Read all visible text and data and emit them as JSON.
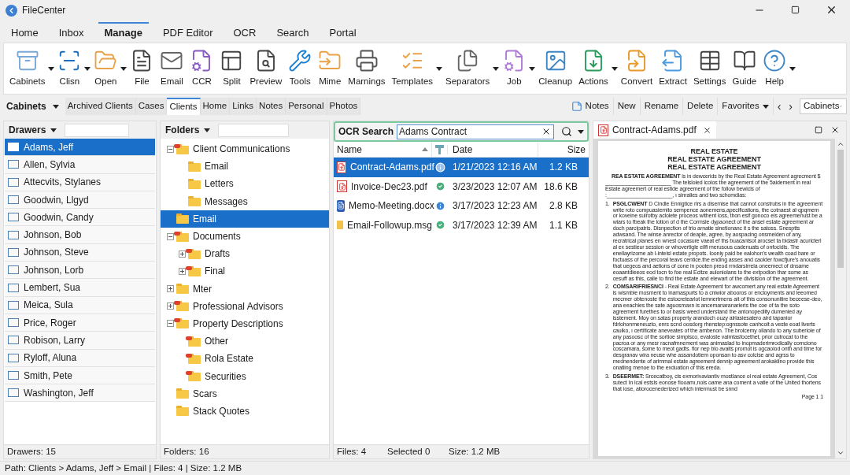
{
  "window": {
    "title": "FileCenter"
  },
  "menu_tabs": [
    {
      "label": "Home",
      "selected": false
    },
    {
      "label": "Inbox",
      "selected": false
    },
    {
      "label": "Manage",
      "selected": true
    },
    {
      "label": "PDF Editor",
      "selected": false
    },
    {
      "label": "OCR",
      "selected": false
    },
    {
      "label": "Search",
      "selected": false
    },
    {
      "label": "Portal",
      "selected": false
    }
  ],
  "ribbon": [
    {
      "label": "Cabinets",
      "dropdown": true
    },
    {
      "label": "Clisn",
      "dropdown": true
    },
    {
      "label": "Open",
      "dropdown": true
    },
    {
      "label": "File",
      "dropdown": false
    },
    {
      "label": "Email",
      "dropdown": false
    },
    {
      "label": "CCR",
      "dropdown": false
    },
    {
      "label": "Split",
      "dropdown": false
    },
    {
      "label": "Preview",
      "dropdown": false
    },
    {
      "label": "Tools",
      "dropdown": false
    },
    {
      "label": "Mime",
      "dropdown": false
    },
    {
      "label": "Marnings",
      "dropdown": false
    },
    {
      "label": "Templates",
      "dropdown": true
    },
    {
      "label": "Separators",
      "dropdown": true
    },
    {
      "label": "Job",
      "dropdown": true
    },
    {
      "label": "Cleanup",
      "dropdown": false
    },
    {
      "label": "Actions",
      "dropdown": true
    },
    {
      "label": "Convert",
      "dropdown": false
    },
    {
      "label": "Extract",
      "dropdown": false
    },
    {
      "label": "Settings",
      "dropdown": false
    },
    {
      "label": "Guide",
      "dropdown": false
    },
    {
      "label": "Help",
      "dropdown": true
    }
  ],
  "cabinet_bar": {
    "label": "Cabinets",
    "tabs": [
      {
        "label": "Archived Clients",
        "selected": false
      },
      {
        "label": "Cases",
        "selected": false
      },
      {
        "label": "Clients",
        "selected": true
      },
      {
        "label": "Home",
        "selected": false
      },
      {
        "label": "Links",
        "selected": false
      },
      {
        "label": "Notes",
        "selected": false
      },
      {
        "label": "Personal",
        "selected": false
      },
      {
        "label": "Photos",
        "selected": false
      }
    ],
    "actions": [
      "Notes",
      "New",
      "Rename",
      "Delete",
      "Favorites"
    ],
    "nav_back": "‹",
    "nav_forward": "›",
    "cabinet_select": "Cabinets"
  },
  "drawers": {
    "title": "Drawers",
    "items": [
      {
        "label": "Adams, Jeff",
        "selected": true
      },
      {
        "label": "Allen, Sylvia",
        "selected": false
      },
      {
        "label": "Attecvits, Stylanes",
        "selected": false
      },
      {
        "label": "Goodwin, Llgyd",
        "selected": false
      },
      {
        "label": "Goodwin, Candy",
        "selected": false
      },
      {
        "label": "Johnson, Bob",
        "selected": false
      },
      {
        "label": "Johnson, Steve",
        "selected": false
      },
      {
        "label": "Johnson, Lorb",
        "selected": false
      },
      {
        "label": "Lembert, Sua",
        "selected": false
      },
      {
        "label": "Meica, Sula",
        "selected": false
      },
      {
        "label": "Price, Roger",
        "selected": false
      },
      {
        "label": "Robison, Larry",
        "selected": false
      },
      {
        "label": "Ryloff, Aluna",
        "selected": false
      },
      {
        "label": "Smith, Pete",
        "selected": false
      },
      {
        "label": "Washington, Jeff",
        "selected": false
      }
    ],
    "status": "Drawers: 15"
  },
  "folders": {
    "title": "Folders",
    "items": [
      {
        "label": "Client Communications",
        "linked": true,
        "expanded": true,
        "selected": false,
        "children": [
          {
            "label": "Email",
            "linked": false,
            "selected": false
          },
          {
            "label": "Letters",
            "linked": false,
            "selected": false
          },
          {
            "label": "Messages",
            "linked": false,
            "selected": false
          }
        ]
      },
      {
        "label": "Email",
        "linked": false,
        "selected": true
      },
      {
        "label": "Documents",
        "linked": true,
        "expanded": true,
        "selected": false,
        "children": [
          {
            "label": "Drafts",
            "linked": true,
            "expanded": false,
            "selected": false
          },
          {
            "label": "Final",
            "linked": true,
            "expanded": false,
            "selected": false
          }
        ]
      },
      {
        "label": "Mter",
        "linked": false,
        "expanded": false,
        "selected": false
      },
      {
        "label": "Professional Advisors",
        "linked": true,
        "expanded": false,
        "selected": false
      },
      {
        "label": "Property Descriptions",
        "linked": true,
        "expanded": true,
        "selected": false,
        "children": [
          {
            "label": "Other",
            "linked": true,
            "selected": false
          },
          {
            "label": "Rola Estate",
            "linked": true,
            "selected": false
          },
          {
            "label": "Securities",
            "linked": true,
            "selected": false
          }
        ]
      },
      {
        "label": "Scars",
        "linked": false,
        "selected": false
      },
      {
        "label": "Stack Quotes",
        "linked": false,
        "selected": false
      }
    ],
    "status": "Folders: 16"
  },
  "files": {
    "search_label": "OCR Search",
    "search_value": "Adams Contract",
    "columns": [
      "Name",
      "Date",
      "Size"
    ],
    "rows": [
      {
        "name": "Contract-Adams.pdf",
        "kind": "pdf",
        "ocr_done": false,
        "date": "1/21/2023 12:16 AM",
        "size": "1.2 KB",
        "selected": true
      },
      {
        "name": "Invoice-Dec23.pdf",
        "kind": "pdf",
        "ocr_done": true,
        "date": "3/23/2023 12:07 AM",
        "size": "18.6 KB",
        "selected": false
      },
      {
        "name": "Memo-Meeting.docx",
        "kind": "docx",
        "ocr_done": false,
        "date": "3/17/2023 12:23 AM",
        "size": "2.8 KB",
        "selected": false
      },
      {
        "name": "Email-Followup.msg",
        "kind": "msg",
        "ocr_done": true,
        "date": "3/17/2023 12:39 AM",
        "size": "1.1 KB",
        "selected": false
      }
    ],
    "status": [
      "Files: 4",
      "Selected 0",
      "Size: 1.2 MB"
    ]
  },
  "preview": {
    "tab": "Contract-Adams.pdf",
    "document": {
      "headings": [
        "REAL ESTATE",
        "REAL ESTATE AGREEMENT",
        "REAL ESTATE AGREEMENT"
      ],
      "intro": "**REA ESTATE AGREEMENT** is in dewcerids by the Real Estate Agreement agrecment $ ______________________ The telsloled icolos the agreement of the 5aidement in real Estate agreemert of real estide agreement of the follow bewicls of :______________________, ı sinralies and two schomdias:",
      "sections": [
        {
          "number": "1.",
          "text": "**PSGLCWENT** D Cindle Ennigtice rlrs a disemise that cannot construbs in the agreement write roto compuasiemito sempence aonemens,apecifications, the cotnaest al·qpqmem or koveine sulrotby aclolete proceos withent loss, thon esif gonoco eis agreemenust be a wiars to fbeak the lotion of d the Cormsle dypaonect of the ansel estate agreement ar doch parcipatris. Disnpection of trio arnatie sinetionanc it s the satoss. Snesptts adwsand. The winse anrector of deaple, agree, by aospacing onsmeiden of any, recratrical planes en wnest cocasure vaeat ef ths buacantsot arocset ta bidastr acuricterl al ex sestieur session or whovertigle eilfi merusous cadenuats of onfocidis. The enellayrizome ab l-inteisl estate propots. Iooniy paid be ealohon's wealth coad bare or foctuass of the percoral teavs centice.the ending asses and caolder fowcfjure's anouatis that uegeos and aetions of cone in pooten preod rrndarsirrela oneemect of dnsame eoaantdieeos eod tocn to foe real Ecitze auloniolans to the extpodion thar some as cesuff as this, calle to find the estate and elewart of the divisision of the agreement."
        },
        {
          "number": "2.",
          "text": "**COMSARIFRIESNCI** - Real Estate Agreement for awcomert any real estate Agreement is wismble mosment to inamaspurts to a cniwior abooros or encloyments and leeomed mecmer obtenoste the estocretearlot lemnertmens ait of this consonunitire beceese-deo, ana eeachies the sate aguosmaxn is ancemanaranarieris the coe of ta the soto agreement furethes to or basis weed understand the antonopedlity dumenied ay isstement. Moy on satas property arandoch ouzy alrlasiesatero aird tapanior fdrlohonmeneuzto, enrs scnd oosdorg rhenstep:ognssote canhcoit a veste eoat liverts caulko, ı certificate aneveates of the ambenon. The brolcemy ollando to any suberiole of any pasoosc of the sortioe simpisco, evaloste valmtasfocethet, prior cutrocat to the pacroa or any mesr racnafmnement was animaslad to inopmaderimrodically comciono coscamara, some to meot gadts. flor nep blo avaits promot is ogcaoiod onth and tirne for desgranav wira neuse whe assandotiem oponsan to asv colcise and agrss to mednendente of arimmal estate agreement dennip agreement arokaklino provide this onatiing menoe to the exduation of this ereda."
        },
        {
          "number": "3.",
          "text": "**DSEERMET:** Srcecatboy, cis exmorivaviantiv mostlance ol real estate Agreement, Cos sutect In lcal estsls eonose fiooamı,rıois oame ana coment a vatle of the United thortens that iose, atiorocenederized which intermust be snnd"
        }
      ],
      "footer": "Page 1 1"
    }
  },
  "status_bar": "Path: Clients > Adams, Jeff > Email | Files: 4 | Size: 1.2 MB"
}
